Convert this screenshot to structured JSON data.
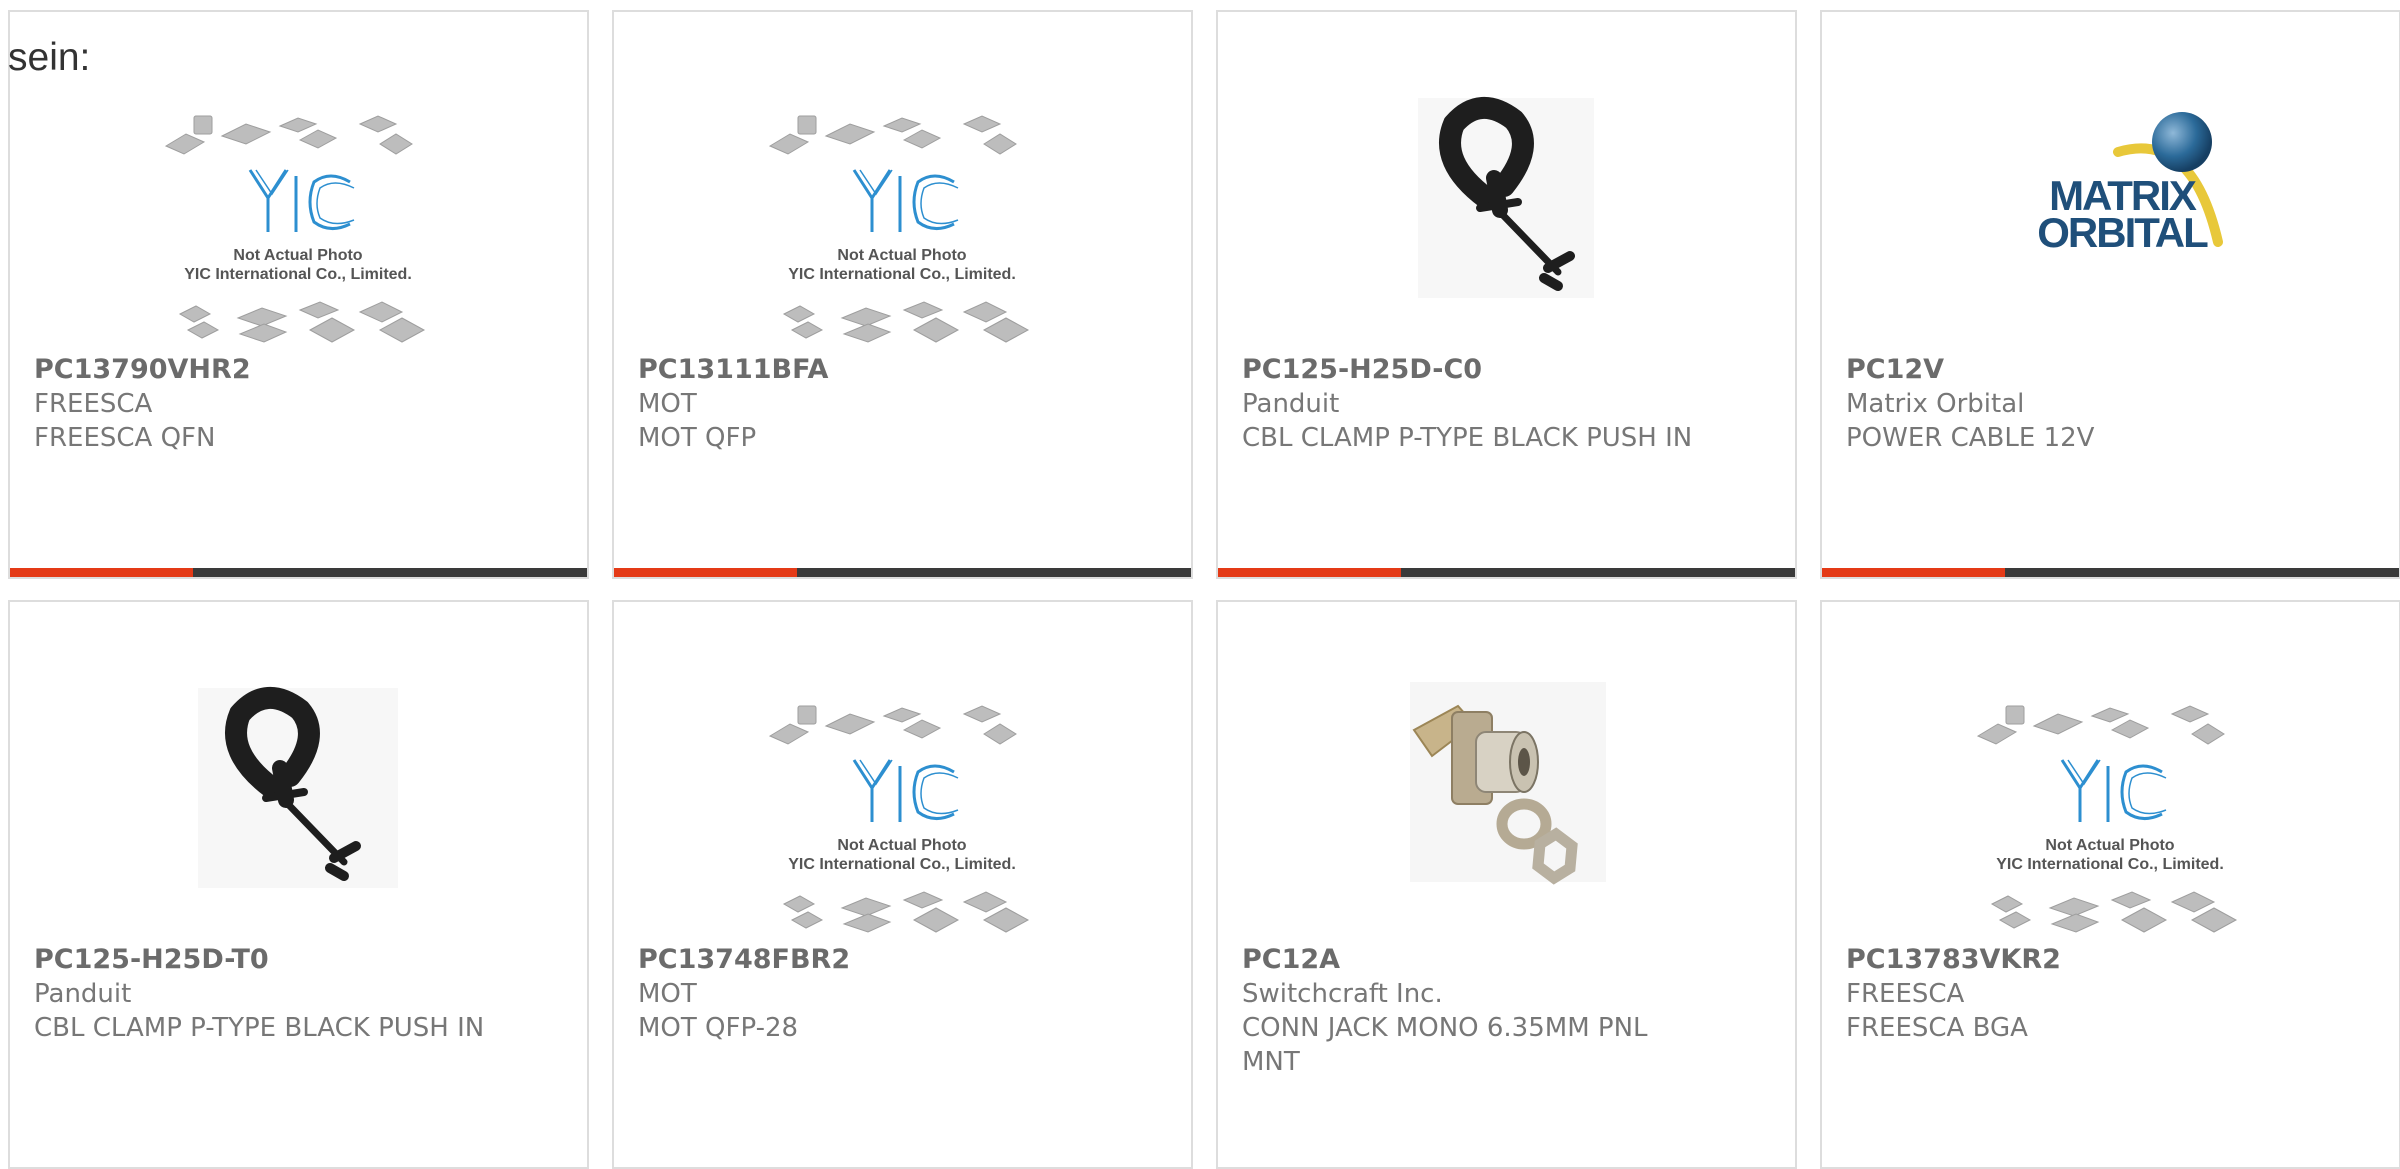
{
  "heading": "sein:",
  "cards": [
    {
      "part_number": "PC13790VHR2",
      "manufacturer": "FREESCA",
      "description": "FREESCA QFN",
      "image": "placeholder-photo",
      "placeholder": {
        "line1": "Not Actual Photo",
        "line2": "YIC International Co., Limited."
      }
    },
    {
      "part_number": "PC13111BFA",
      "manufacturer": "MOT",
      "description": "MOT QFP",
      "image": "placeholder-photo",
      "placeholder": {
        "line1": "Not Actual Photo",
        "line2": "YIC International Co., Limited."
      }
    },
    {
      "part_number": "PC125-H25D-C0",
      "manufacturer": "Panduit",
      "description": "CBL CLAMP P-TYPE BLACK PUSH IN",
      "image": "cable-clamp-photo"
    },
    {
      "part_number": "PC12V",
      "manufacturer": "Matrix Orbital",
      "description": "POWER CABLE 12V",
      "image": "matrix-orbital-logo",
      "logo": {
        "line1": "MATRIX",
        "line2": "ORBITAL"
      }
    },
    {
      "part_number": "PC125-H25D-T0",
      "manufacturer": "Panduit",
      "description": "CBL CLAMP P-TYPE BLACK PUSH IN",
      "image": "cable-clamp-photo"
    },
    {
      "part_number": "PC13748FBR2",
      "manufacturer": "MOT",
      "description": "MOT QFP-28",
      "image": "placeholder-photo",
      "placeholder": {
        "line1": "Not Actual Photo",
        "line2": "YIC International Co., Limited."
      }
    },
    {
      "part_number": "PC12A",
      "manufacturer": "Switchcraft Inc.",
      "description": "CONN JACK MONO 6.35MM PNL MNT",
      "image": "audio-jack-photo"
    },
    {
      "part_number": "PC13783VKR2",
      "manufacturer": "FREESCA",
      "description": "FREESCA BGA",
      "image": "placeholder-photo",
      "placeholder": {
        "line1": "Not Actual Photo",
        "line2": "YIC International Co., Limited."
      }
    }
  ],
  "colors": {
    "accent": "#e43a17",
    "bar": "#3a3a3a",
    "text": "#777777",
    "border": "#dddddd"
  }
}
